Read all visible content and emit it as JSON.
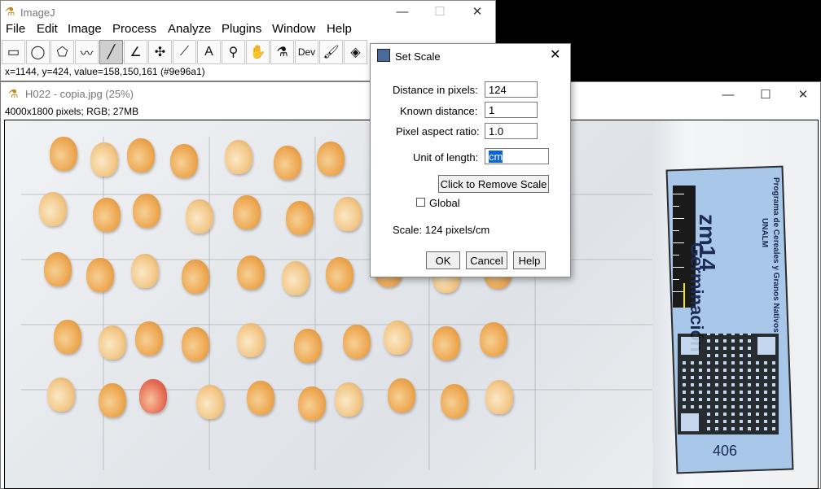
{
  "imagej": {
    "title": "ImageJ",
    "menu": [
      "File",
      "Edit",
      "Image",
      "Process",
      "Analyze",
      "Plugins",
      "Window",
      "Help"
    ],
    "tools": [
      {
        "name": "rectangle-tool-icon",
        "glyph": "▭"
      },
      {
        "name": "oval-tool-icon",
        "glyph": "◯"
      },
      {
        "name": "polygon-tool-icon",
        "glyph": "⬠"
      },
      {
        "name": "freehand-tool-icon",
        "glyph": "〰"
      },
      {
        "name": "line-tool-icon",
        "glyph": "╱"
      },
      {
        "name": "angle-tool-icon",
        "glyph": "∠"
      },
      {
        "name": "point-tool-icon",
        "glyph": "✣"
      },
      {
        "name": "wand-tool-icon",
        "glyph": "⟋"
      },
      {
        "name": "text-tool-icon",
        "glyph": "A"
      },
      {
        "name": "magnifier-tool-icon",
        "glyph": "⚲"
      },
      {
        "name": "hand-tool-icon",
        "glyph": "✋"
      },
      {
        "name": "dropper-tool-icon",
        "glyph": "⚗"
      },
      {
        "name": "dev-tool-icon",
        "glyph": "Dev"
      },
      {
        "name": "brush-tool-icon",
        "glyph": "🖌"
      },
      {
        "name": "flood-fill-tool-icon",
        "glyph": "◈"
      }
    ],
    "status": "x=1144, y=424, value=158,150,161 (#9e96a1)"
  },
  "image_window": {
    "title": "H022 - copia.jpg (25%)",
    "info": "4000x1800 pixels; RGB; 27MB",
    "sample_label": {
      "heading": "Germinación",
      "code": "zm14",
      "program": "Programa de Cereales y Granos Nativos",
      "org": "UNALM",
      "number": "406"
    }
  },
  "dialog": {
    "title": "Set Scale",
    "distance_label": "Distance in pixels:",
    "distance_value": "124",
    "known_label": "Known distance:",
    "known_value": "1",
    "aspect_label": "Pixel aspect ratio:",
    "aspect_value": "1.0",
    "unit_label": "Unit of length:",
    "unit_value": "cm",
    "remove_scale": "Click to Remove Scale",
    "global_label": "Global",
    "scale_text": "Scale: 124 pixels/cm",
    "ok": "OK",
    "cancel": "Cancel",
    "help": "Help"
  },
  "colors": {
    "label_blue": "#a8c7e9",
    "selection": "#0a64d6"
  }
}
